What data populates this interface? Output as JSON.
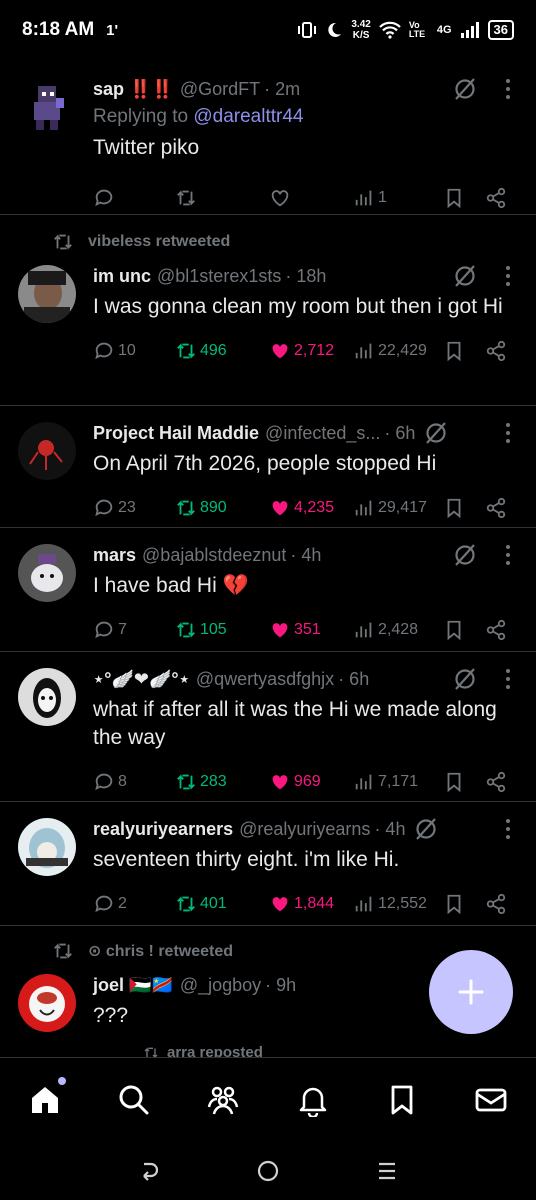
{
  "status_bar": {
    "time": "8:18 AM",
    "notification": "1'",
    "speed_value": "3.42",
    "speed_unit": "K/S",
    "volte": "Vo LTE",
    "network": "4G",
    "battery": "36"
  },
  "tweets": [
    {
      "repost_by": "",
      "name": "sap ‼️‼️",
      "handle": "@GordFT",
      "time": "· 2m",
      "replying_prefix": "Replying to ",
      "replying_to": "@darealttr44",
      "text": "Twitter piko",
      "replies": "",
      "reposts": "",
      "likes": "",
      "views": "1",
      "avatar_color": "#4a3a6a"
    },
    {
      "repost_by": "vibeless retweeted",
      "name": "im unc",
      "handle": "@bl1sterex1sts",
      "time": "· 18h",
      "text": "I was gonna clean my room but then i got Hi",
      "replies": "10",
      "reposts": "496",
      "likes": "2,712",
      "views": "22,429",
      "avatar_color": "#6b5a4e"
    },
    {
      "repost_by": "",
      "name": "Project Hail Maddie",
      "handle": "@infected_s...",
      "time": "· 6h",
      "text": "On April 7th 2026, people stopped Hi",
      "replies": "23",
      "reposts": "890",
      "likes": "4,235",
      "views": "29,417",
      "avatar_color": "#1a1a1a"
    },
    {
      "repost_by": "",
      "name": "mars",
      "handle": "@bajablstdeeznut",
      "time": "· 4h",
      "text": "I have bad Hi 💔",
      "replies": "7",
      "reposts": "105",
      "likes": "351",
      "views": "2,428",
      "avatar_color": "#6a6070"
    },
    {
      "repost_by": "",
      "name": "⋆°🪽❤︎🪽°⋆",
      "handle": "@qwertyasdfghjx",
      "time": "· 6h",
      "text": "what if after all it was the Hi we made along the way",
      "replies": "8",
      "reposts": "283",
      "likes": "969",
      "views": "7,171",
      "avatar_color": "#2a2a2a"
    },
    {
      "repost_by": "",
      "name": "realyuriyearners",
      "handle": "@realyuriyearns",
      "time": "· 4h",
      "text": "seventeen thirty eight. i'm like Hi.",
      "replies": "2",
      "reposts": "401",
      "likes": "1,844",
      "views": "12,552",
      "avatar_color": "#9fb6c6"
    },
    {
      "repost_by": "⊙ chris ! retweeted",
      "name": "joel 🇵🇸🇨🇩",
      "handle": "@_jogboy",
      "time": "· 9h",
      "text": "???",
      "next_repost": "arra reposted",
      "avatar_color": "#d61a1a"
    }
  ],
  "colors": {
    "accent": "#c6c5ff",
    "retweet": "#00ba7c",
    "like": "#f91880",
    "muted": "#71767b",
    "mention": "#8e8fe8"
  },
  "bottom_nav": [
    "home-icon",
    "search-icon",
    "communities-icon",
    "notifications-icon",
    "bookmarks-icon",
    "messages-icon"
  ],
  "system_nav": [
    "back-icon",
    "home-circle-icon",
    "recents-icon"
  ]
}
